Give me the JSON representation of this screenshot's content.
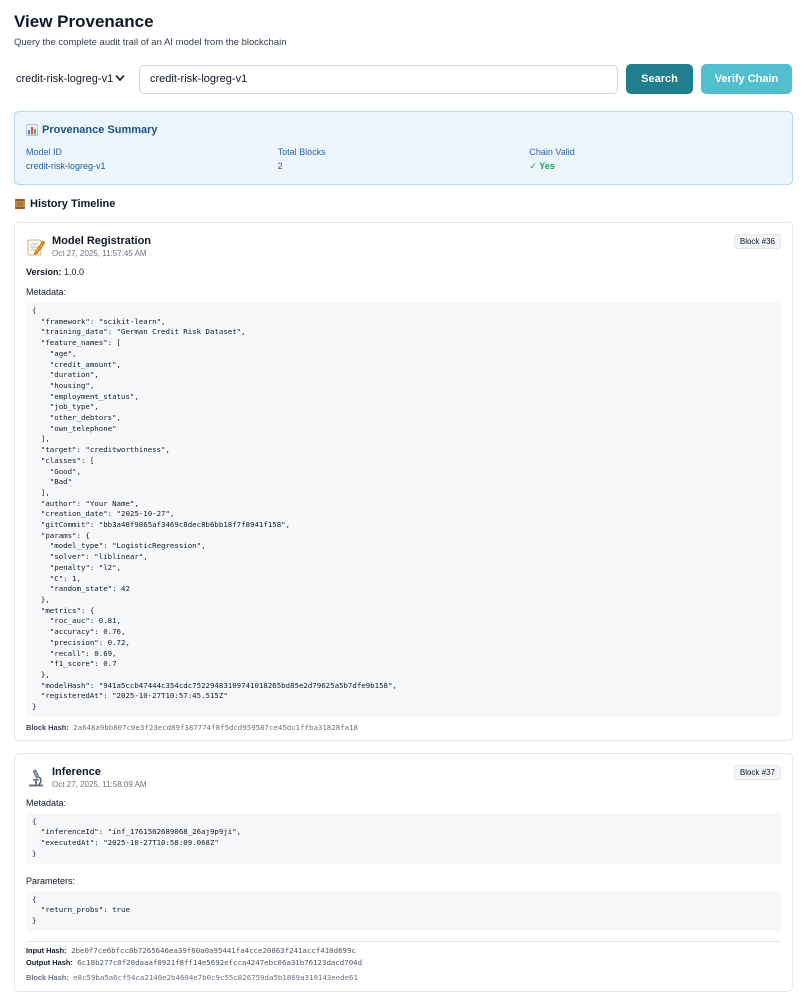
{
  "header": {
    "title": "View Provenance",
    "subtitle": "Query the complete audit trail of an AI model from the blockchain"
  },
  "search": {
    "selected_model": "credit-risk-logreg-v1",
    "input_value": "credit-risk-logreg-v1",
    "search_label": "Search",
    "verify_label": "Verify Chain"
  },
  "summary": {
    "title": "Provenance Summary",
    "icon": "bar-chart-icon",
    "model_id_label": "Model ID",
    "model_id_value": "credit-risk-logreg-v1",
    "total_blocks_label": "Total Blocks",
    "total_blocks_value": "2",
    "chain_valid_label": "Chain Valid",
    "chain_valid_value": "✓ Yes"
  },
  "timeline": {
    "title": "History Timeline",
    "icon": "scroll-icon"
  },
  "events": [
    {
      "title": "Model Registration",
      "time": "Oct 27, 2025, 11:57:45 AM",
      "block": "Block #36",
      "icon": "memo-icon",
      "version_label": "Version:",
      "version_value": "1.0.0",
      "metadata_label": "Metadata:",
      "metadata": "{\n  \"framework\": \"scikit-learn\",\n  \"training_data\": \"German Credit Risk Dataset\",\n  \"feature_names\": [\n    \"age\",\n    \"credit_amount\",\n    \"duration\",\n    \"housing\",\n    \"employment_status\",\n    \"job_type\",\n    \"other_debtors\",\n    \"own_telephone\"\n  ],\n  \"target\": \"creditworthiness\",\n  \"classes\": [\n    \"Good\",\n    \"Bad\"\n  ],\n  \"author\": \"Your Name\",\n  \"creation_date\": \"2025-10-27\",\n  \"gitCommit\": \"bb3a48f9865af3469c8dec8b6bb18f7f8941f158\",\n  \"params\": {\n    \"model_type\": \"LogisticRegression\",\n    \"solver\": \"liblinear\",\n    \"penalty\": \"l2\",\n    \"C\": 1,\n    \"random_state\": 42\n  },\n  \"metrics\": {\n    \"roc_auc\": 0.81,\n    \"accuracy\": 0.76,\n    \"precision\": 0.72,\n    \"recall\": 0.69,\n    \"f1_score\": 0.7\n  },\n  \"modelHash\": \"941a5ccb47444c354cdc75229483109741018265bd85e2d79625a5b7dfe9b158\",\n  \"registeredAt\": \"2025-10-27T10:57:45.515Z\"\n}",
      "block_hash_label": "Block Hash:",
      "block_hash": "2a648a9bb807c0e3f23ecd89f387774f8f5dcd959587ce45dc1ffba31828fa18"
    },
    {
      "title": "Inference",
      "time": "Oct 27, 2025, 11:58:09 AM",
      "block": "Block #37",
      "icon": "microscope-icon",
      "metadata_label": "Metadata:",
      "metadata": "{\n  \"inferenceId\": \"inf_1761562689068_26aj9p9ji\",\n  \"executedAt\": \"2025-10-27T10:58:09.068Z\"\n}",
      "parameters_label": "Parameters:",
      "parameters": "{\n  \"return_probs\": true\n}",
      "input_hash_label": "Input Hash:",
      "input_hash": "2be0f7ce6bfcc8b7265646ea39f60a0a95441fa4cce20863f241accf410d699c",
      "output_hash_label": "Output Hash:",
      "output_hash": "6c18b277c0f20daaaf0921f8ff14e5692efcca4247ebc06a31b76123dacd704d",
      "block_hash_label": "Block Hash:",
      "block_hash": "e8c59ba5a6cf54ca2140e2b4694e7b0c9c55c826759da5b1869a319143eede61"
    }
  ]
}
